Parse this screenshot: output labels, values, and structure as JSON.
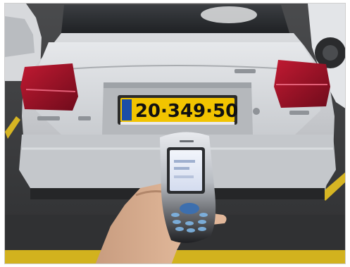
{
  "scene": {
    "license_plate_number": "20·349·50",
    "colors": {
      "car_body": "#c9cbcf",
      "plate_yellow": "#f2c400",
      "taillight_red": "#a3122a",
      "phone_screen": "#dfe8f7",
      "phone_body": "#2a2c2f"
    }
  }
}
